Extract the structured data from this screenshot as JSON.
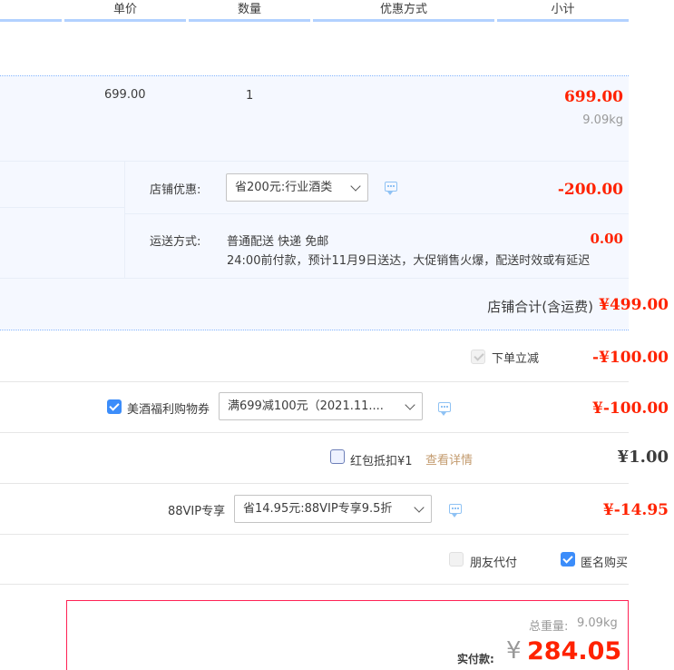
{
  "header": {
    "unit_price": "单价",
    "quantity": "数量",
    "discount_method": "优惠方式",
    "subtotal": "小计"
  },
  "item": {
    "unit_price": "699.00",
    "quantity": "1",
    "subtotal": "699.00",
    "weight": "9.09kg"
  },
  "shop_discount": {
    "label": "店铺优惠:",
    "selected": "省200元:行业酒类",
    "amount": "-200.00"
  },
  "shipping": {
    "label": "运送方式:",
    "method": "普通配送 快递 免邮",
    "note": "24:00前付款，预计11月9日送达，大促销售火爆，配送时效或有延迟",
    "amount": "0.00"
  },
  "shop_total": {
    "label": "店铺合计(含运费)",
    "amount": "¥499.00"
  },
  "order_reduce": {
    "label": "下单立减",
    "amount": "-¥100.00"
  },
  "coupon": {
    "label": "美酒福利购物券",
    "selected": "满699减100元（2021.11....",
    "amount": "¥-100.00"
  },
  "red_packet": {
    "label": "红包抵扣¥1",
    "link": "查看详情",
    "amount": "¥1.00"
  },
  "vip": {
    "label": "88VIP专享",
    "selected": "省14.95元:88VIP专享9.5折",
    "amount": "¥-14.95"
  },
  "options": {
    "friend_pay": "朋友代付",
    "anonymous": "匿名购买"
  },
  "summary": {
    "weight_label": "总重量:",
    "weight": "9.09kg",
    "pay_label": "实付款:",
    "currency": "¥",
    "pay_amount": "284.05"
  },
  "colors": {
    "price_red": "#ff2200",
    "accent_blue": "#3c8dfa",
    "header_line": "#b2d1ff",
    "band_bg": "#f5f8ff"
  }
}
